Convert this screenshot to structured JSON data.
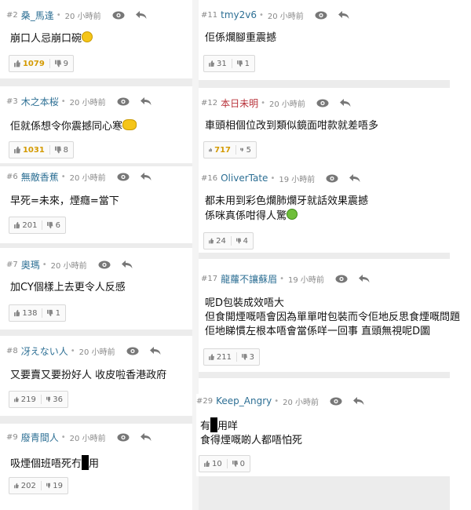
{
  "left": [
    {
      "num": "#2",
      "user": "桑_馬逢",
      "time": "20 小時前",
      "text": [
        "崩口人忌崩口碗"
      ],
      "emoji": "smile",
      "up": "1079",
      "down": "9",
      "gold": true
    },
    {
      "num": "#3",
      "user": "木之本桜",
      "time": "20 小時前",
      "text": [
        "佢就係想令你震撼同心寒"
      ],
      "emoji": "sweat",
      "up": "1031",
      "down": "8",
      "gold": true
    },
    {
      "num": "#6",
      "user": "無敵香蕉",
      "time": "20 小時前",
      "text": [
        "早死=未來，煙癮=當下"
      ],
      "up": "201",
      "down": "6",
      "gold": false
    },
    {
      "num": "#7",
      "user": "奧瑪",
      "time": "20 小時前",
      "text": [
        "加CY個樣上去更令人反感"
      ],
      "up": "138",
      "down": "1",
      "gold": false
    },
    {
      "num": "#8",
      "user": "冴えない人",
      "time": "20 小時前",
      "text": [
        "又要賣又要扮好人 收皮啦香港政府"
      ],
      "up": "219",
      "down": "36",
      "gold": false
    },
    {
      "num": "#9",
      "user": "廢青間人",
      "time": "20 小時前",
      "text_before": "吸煙個班唔死冇",
      "text_after": "用",
      "up": "202",
      "down": "19",
      "gold": false
    }
  ],
  "right": [
    {
      "num": "#11",
      "user": "tmy2v6",
      "time": "20 小時前",
      "text": [
        "佢係爛腳重震撼"
      ],
      "up": "31",
      "down": "1",
      "gold": false
    },
    {
      "num": "#12",
      "user": "本日未明",
      "time": "20 小時前",
      "text": [
        "車頭相個位改到類似鏡面咁款就差唔多"
      ],
      "up": "717",
      "down": "5",
      "gold": true,
      "red": true
    },
    {
      "num": "#16",
      "user": "OliverTate",
      "time": "19 小時前",
      "text": [
        "都未用到彩色爛肺爛牙就話效果震撼",
        "係咪真係咁得人驚"
      ],
      "emoji": "sick",
      "up": "24",
      "down": "4",
      "gold": false
    },
    {
      "num": "#17",
      "user": "龍蘿不讓蘇眉",
      "time": "19 小時前",
      "text": [
        "呢D包裝成效唔大",
        "但食開煙嘅唔會因為單單咁包裝而令佢地反思食煙嘅問題",
        "佢地睇慣左根本唔會當係咩一回事 直頭無視呢D圖"
      ],
      "up": "211",
      "down": "3",
      "gold": false
    },
    {
      "num": "#29",
      "user": "Keep_Angry",
      "time": "20 小時前",
      "text_before": "有",
      "text_after": "用咩",
      "text2": "食得煙嘅啲人都唔怕死",
      "up": "10",
      "down": "0",
      "gold": false
    }
  ]
}
